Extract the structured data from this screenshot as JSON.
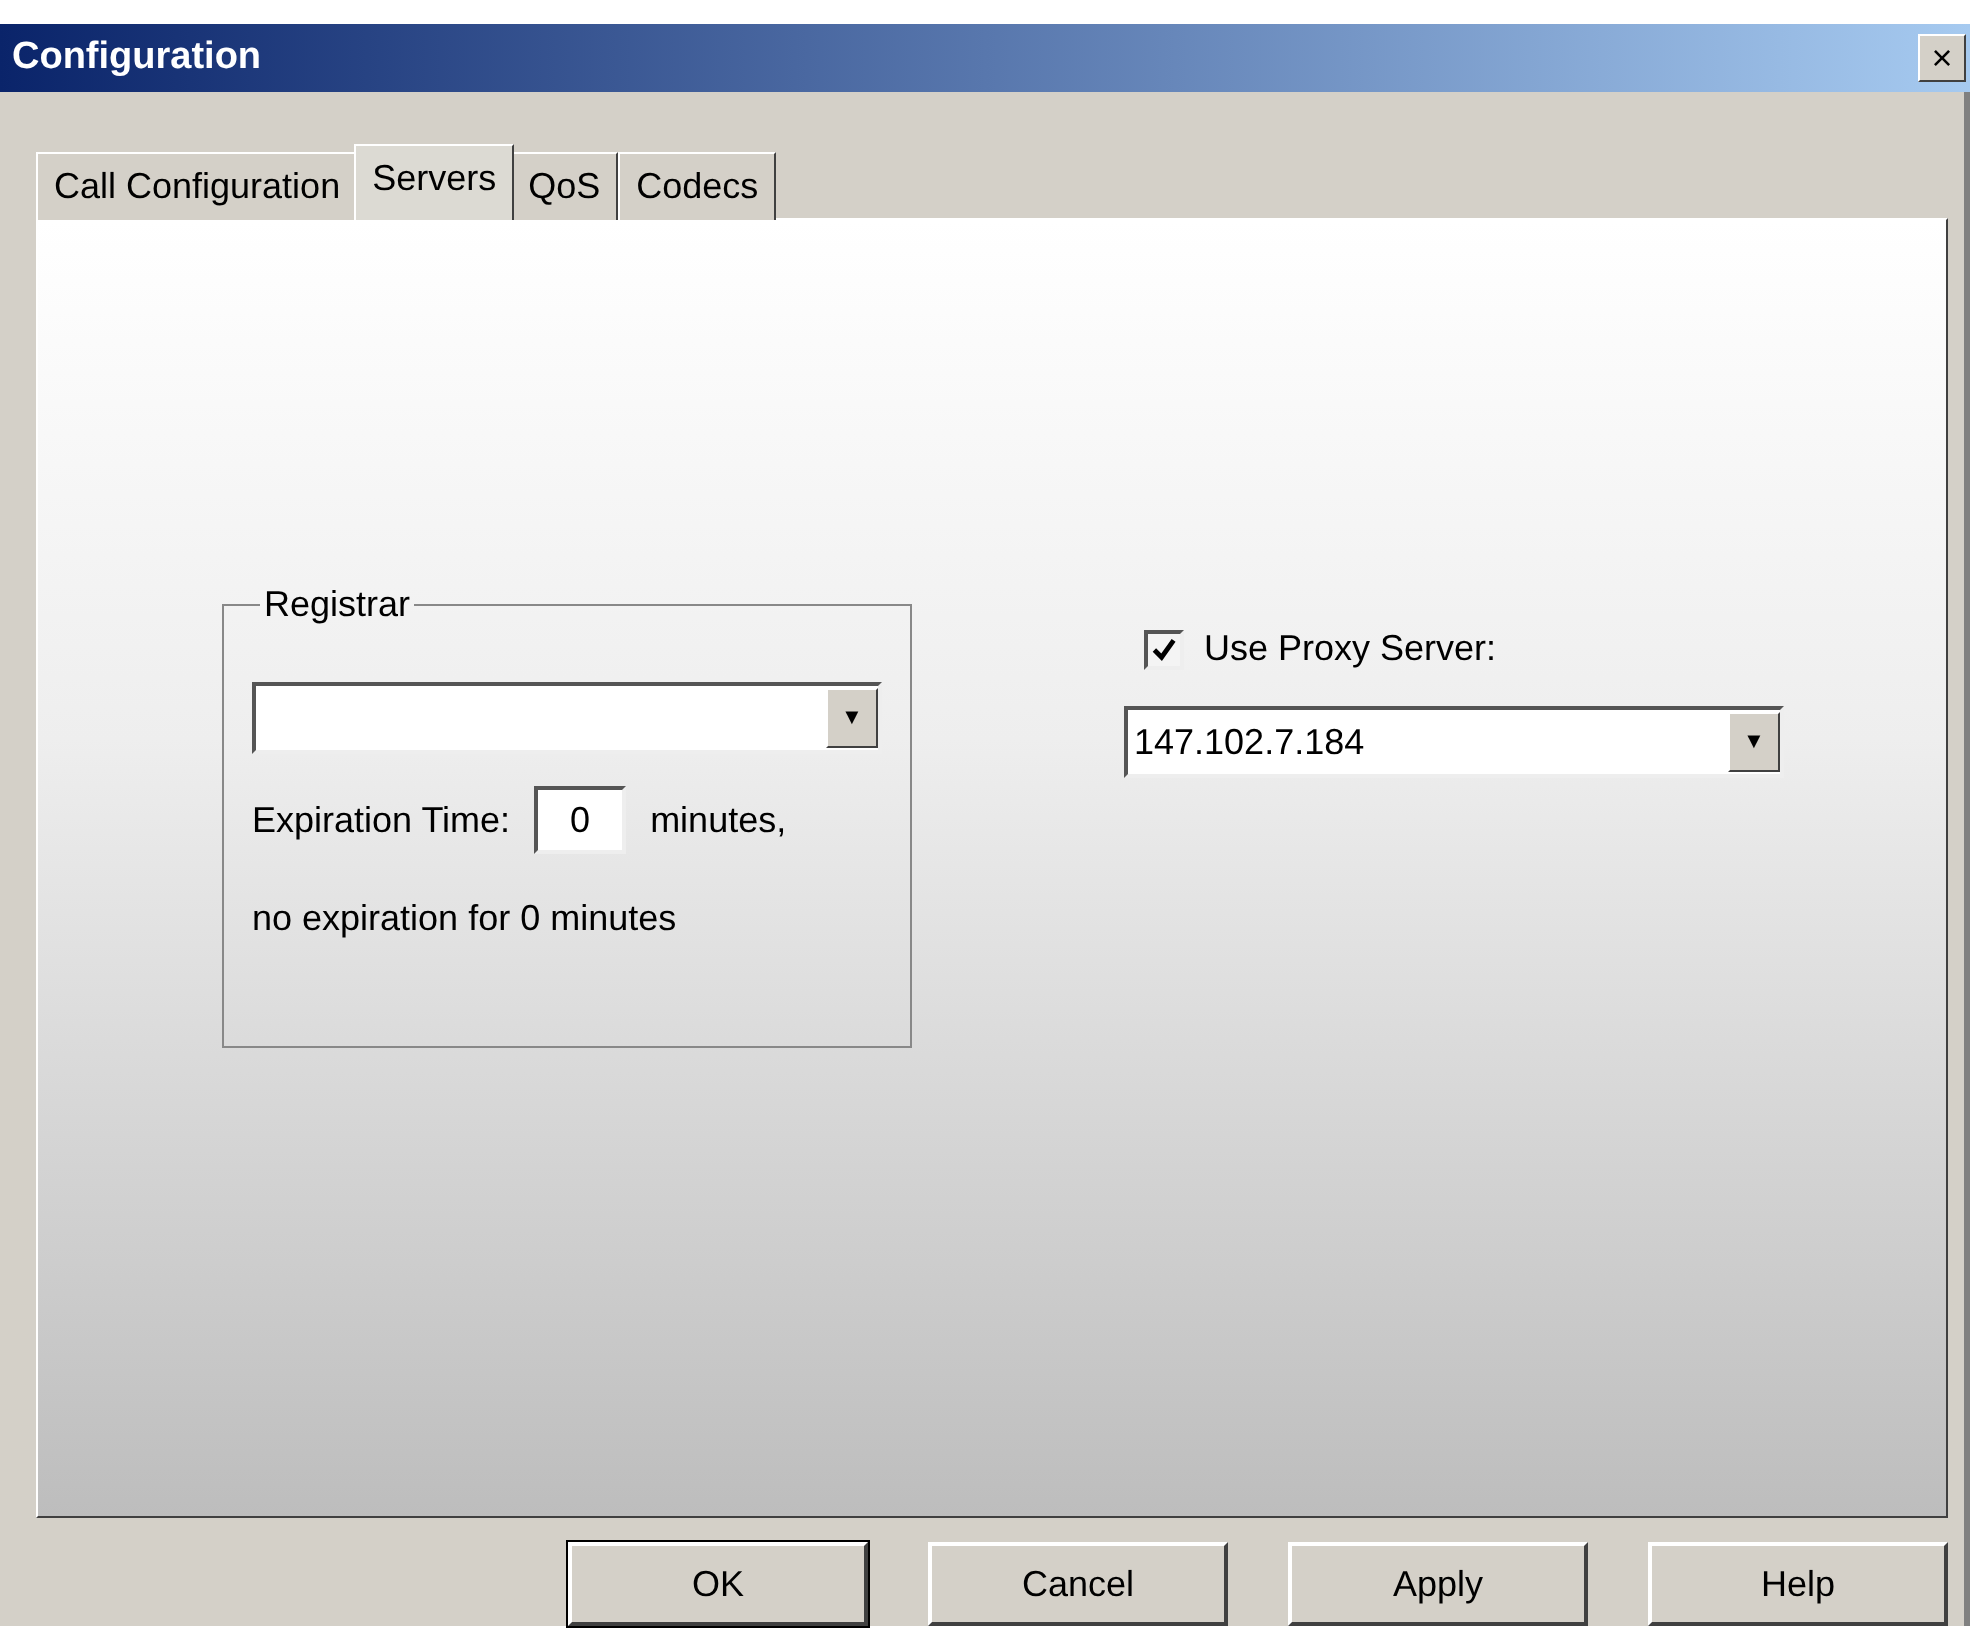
{
  "window": {
    "title": "Configuration",
    "close": "×"
  },
  "tabs": [
    {
      "label": "Call Configuration",
      "selected": false
    },
    {
      "label": "Servers",
      "selected": true
    },
    {
      "label": "QoS",
      "selected": false
    },
    {
      "label": "Codecs",
      "selected": false
    }
  ],
  "registrar": {
    "legend": "Registrar",
    "server": {
      "arrow": "▼"
    },
    "expiration_label": "Expiration Time:",
    "expiration_value": "0",
    "expiration_unit": "minutes,",
    "note": "no expiration for 0 minutes"
  },
  "proxy": {
    "label": "Use Proxy Server:",
    "checked": true,
    "server": {
      "value": "147.102.7.184",
      "arrow": "▼"
    }
  },
  "buttons": [
    {
      "label": "OK",
      "default": true
    },
    {
      "label": "Cancel",
      "default": false
    },
    {
      "label": "Apply",
      "default": false
    },
    {
      "label": "Help",
      "default": false
    }
  ]
}
